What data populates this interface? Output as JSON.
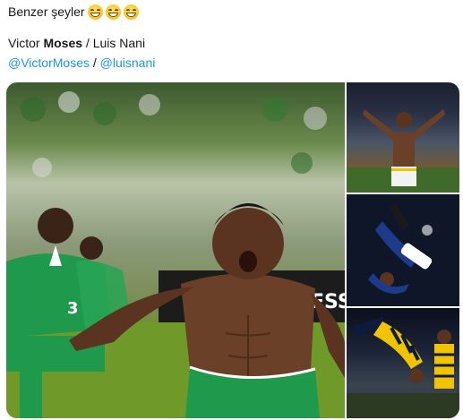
{
  "tweet": {
    "intro": "Benzer şeyler",
    "emojis": [
      "grinning-squinting-face",
      "grinning-squinting-face",
      "grinning-squinting-face"
    ],
    "names": {
      "first": "Victor",
      "bold": "Moses",
      "separator": "/",
      "second": "Luis Nani"
    },
    "mentions": [
      "@VictorMoses",
      "@luisnani"
    ],
    "mention_separator": "/"
  },
  "colors": {
    "link": "#1b95e0",
    "text": "#14171a",
    "nigeria_green": "#1f9a4c"
  },
  "media": {
    "main_photo": "nigeria-player-celebrating-shirtless",
    "side_photos": [
      "player-celebrating-arms-wide",
      "backflip-celebration-blue-kit",
      "backflip-celebration-yellow-navy-kit"
    ],
    "main_jersey_number": "3",
    "banner_text": "ESS"
  }
}
